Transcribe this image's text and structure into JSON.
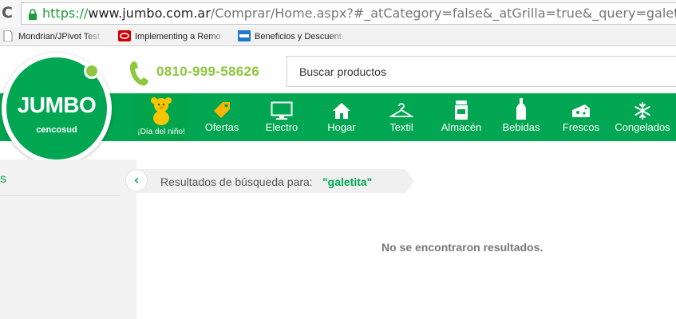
{
  "browser": {
    "url_https": "https://",
    "url_host": "www.jumbo.com.ar",
    "url_path": "/Comprar/Home.aspx?#_atCategory=false&_atGrilla=true&_query=galetita",
    "bookmarks": [
      {
        "label": "Mondrian/JPivot Test"
      },
      {
        "label": "Implementing a Remo"
      },
      {
        "label": "Beneficios y Descuent"
      }
    ]
  },
  "header": {
    "logo_word": "JUMBO",
    "logo_sub": "cencosud",
    "phone": "0810-999-58626",
    "search_placeholder": "Buscar productos"
  },
  "nav": {
    "items": [
      {
        "label": "¡Día del niño!",
        "icon": "teddy-bear-icon"
      },
      {
        "label": "Ofertas",
        "icon": "tag-icon"
      },
      {
        "label": "Electro",
        "icon": "monitor-icon"
      },
      {
        "label": "Hogar",
        "icon": "house-icon"
      },
      {
        "label": "Textil",
        "icon": "hanger-icon"
      },
      {
        "label": "Almacén",
        "icon": "jar-icon"
      },
      {
        "label": "Bebidas",
        "icon": "bottle-icon"
      },
      {
        "label": "Frescos",
        "icon": "cheese-icon"
      },
      {
        "label": "Congelados",
        "icon": "snowflake-icon"
      }
    ]
  },
  "content": {
    "sidebar_text": "s",
    "results_label": "Resultados de búsqueda para:",
    "results_query": "\"galetita\"",
    "no_results": "No se encontraron resultados."
  },
  "colors": {
    "brand_green": "#00a651",
    "accent_lime": "#8dc63f",
    "offer_yellow": "#f7b500"
  }
}
